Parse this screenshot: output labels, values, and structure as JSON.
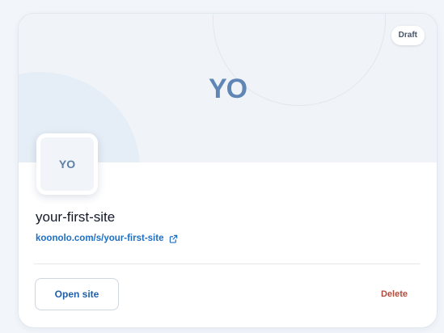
{
  "cover": {
    "initials": "YO"
  },
  "status_badge": "Draft",
  "avatar": {
    "initials": "YO"
  },
  "site": {
    "name": "your-first-site",
    "url": "koonolo.com/s/your-first-site"
  },
  "actions": {
    "open_label": "Open site",
    "delete_label": "Delete"
  },
  "icons": {
    "url_link": "external-link-icon"
  },
  "colors": {
    "accent": "#1d6fc4",
    "cover_initials": "#5f86b4",
    "danger": "#b14a3a",
    "cover_bg": "#f0f4f9"
  }
}
